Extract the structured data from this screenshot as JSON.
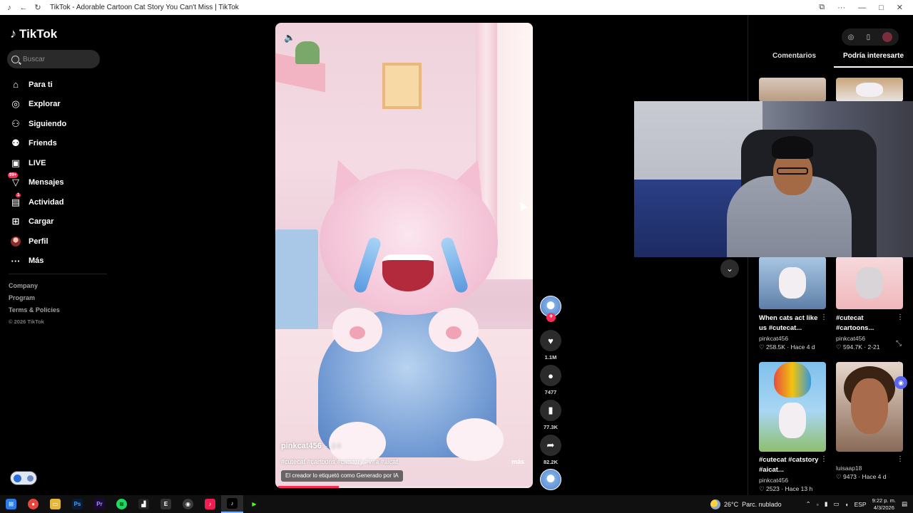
{
  "browser": {
    "title": "TikTok - Adorable Cartoon Cat Story You Can't Miss | TikTok"
  },
  "sidebar": {
    "logo": "TikTok",
    "search_placeholder": "Buscar",
    "items": [
      {
        "label": "Para ti",
        "icon": "home-icon"
      },
      {
        "label": "Explorar",
        "icon": "compass-icon"
      },
      {
        "label": "Siguiendo",
        "icon": "following-icon"
      },
      {
        "label": "Friends",
        "icon": "friends-icon"
      },
      {
        "label": "LIVE",
        "icon": "live-icon"
      },
      {
        "label": "Mensajes",
        "icon": "messages-icon",
        "badge": "99+"
      },
      {
        "label": "Actividad",
        "icon": "activity-icon",
        "badge": "1"
      },
      {
        "label": "Cargar",
        "icon": "upload-icon"
      },
      {
        "label": "Perfil",
        "icon": "profile-avatar"
      },
      {
        "label": "Más",
        "icon": "more-icon"
      }
    ],
    "footer": [
      "Company",
      "Program",
      "Terms & Policies",
      "© 2026 TikTok"
    ]
  },
  "video": {
    "author": "pinkcat456",
    "date": "2-9",
    "caption": "#cutecat #cartoons #catstory #vira #aicat",
    "more_label": "más",
    "ai_label": "El creador lo etiquetó como Generado por IA",
    "progress": 0.24
  },
  "actions": {
    "likes": "1.1M",
    "comments": "7477",
    "saves": "77.3K",
    "shares": "82.2K"
  },
  "right_panel": {
    "tabs": [
      "Comentarios",
      "Podría interesarte"
    ],
    "active_tab": 1,
    "cards": [
      {
        "title": "When cats act like us #cutecat...",
        "user": "pinkcat456",
        "likes": "258.5K",
        "when": "Hace 4 d"
      },
      {
        "title": "#cutecat #cartoons...",
        "user": "pinkcat456",
        "likes": "594.7K",
        "when": "2-21"
      },
      {
        "title": "#cutecat #catstory #aicat...",
        "user": "pinkcat456",
        "likes": "2523",
        "when": "Hace 13 h"
      },
      {
        "title": "",
        "user": "luisaap18",
        "likes": "9473",
        "when": "Hace 4 d"
      }
    ]
  },
  "taskbar": {
    "weather": "26°C",
    "weather_desc": "Parc. nublado",
    "lang": "ESP",
    "time": "9:22 p. m.",
    "date": "4/3/2026"
  },
  "colors": {
    "accent": "#fe2c55",
    "background": "#000000"
  }
}
